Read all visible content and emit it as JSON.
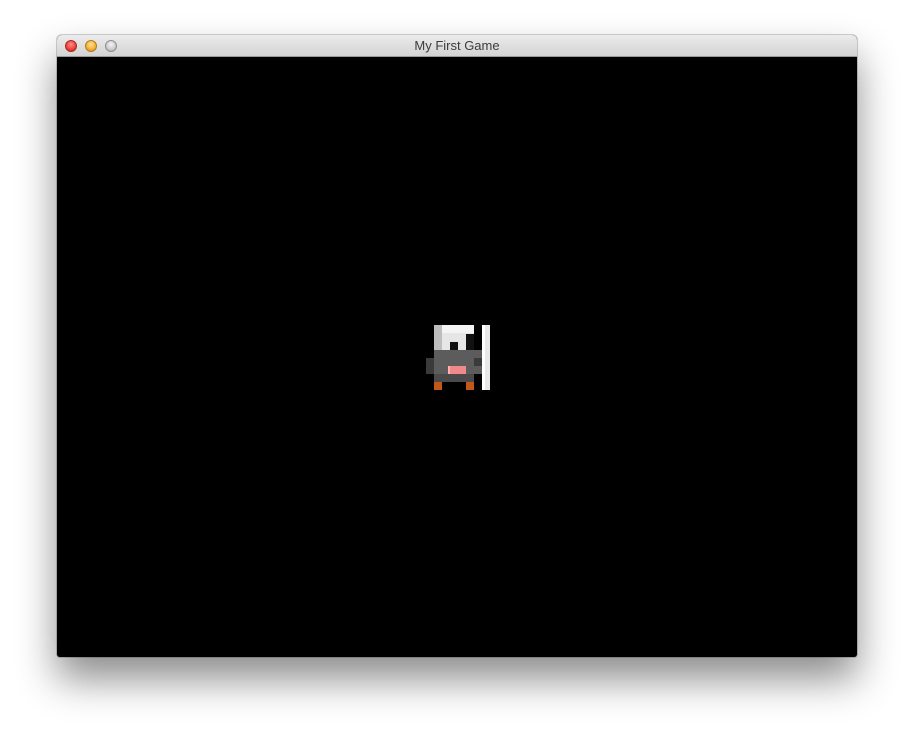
{
  "window": {
    "title": "My First Game",
    "buttons": {
      "close": "close",
      "minimize": "minimize",
      "zoom": "zoom"
    }
  },
  "game": {
    "background_color": "#000000",
    "player": {
      "sprite": "knight-with-sword",
      "colors": {
        "helmet": "#e6e6e6",
        "visor": "#111111",
        "armor": "#5c5c5c",
        "armor_dark": "#3a3a3a",
        "face": "#f08a8a",
        "boots": "#c2571a",
        "sword": "#e8e8e8"
      }
    }
  }
}
